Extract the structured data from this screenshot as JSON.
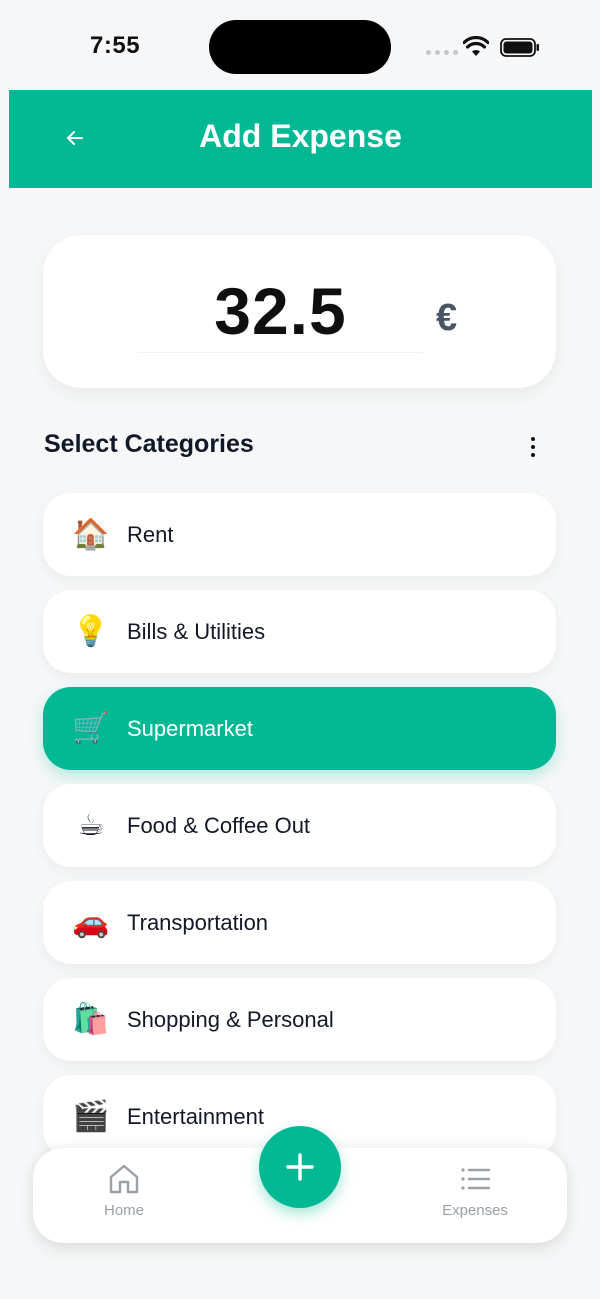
{
  "status_bar": {
    "time": "7:55"
  },
  "header": {
    "title": "Add Expense"
  },
  "amount": {
    "value": "32.5",
    "currency": "€"
  },
  "categories_section": {
    "title": "Select Categories"
  },
  "categories": [
    {
      "label": "Rent",
      "icon": "🏠",
      "icon_name": "house-icon",
      "selected": false
    },
    {
      "label": "Bills & Utilities",
      "icon": "💡",
      "icon_name": "lightbulb-icon",
      "selected": false
    },
    {
      "label": "Supermarket",
      "icon": "🛒",
      "icon_name": "shopping-cart-icon",
      "selected": true
    },
    {
      "label": "Food & Coffee Out",
      "icon": "☕",
      "icon_name": "coffee-icon",
      "selected": false
    },
    {
      "label": "Transportation",
      "icon": "🚗",
      "icon_name": "car-icon",
      "selected": false
    },
    {
      "label": "Shopping & Personal",
      "icon": "🛍️",
      "icon_name": "shopping-bags-icon",
      "selected": false
    },
    {
      "label": "Entertainment",
      "icon": "🎬",
      "icon_name": "clapper-board-icon",
      "selected": false
    }
  ],
  "bottom_nav": {
    "home_label": "Home",
    "expenses_label": "Expenses"
  },
  "colors": {
    "accent": "#00b894",
    "background": "#f5f7f8",
    "text": "#111827",
    "muted": "#9aa0a8"
  }
}
